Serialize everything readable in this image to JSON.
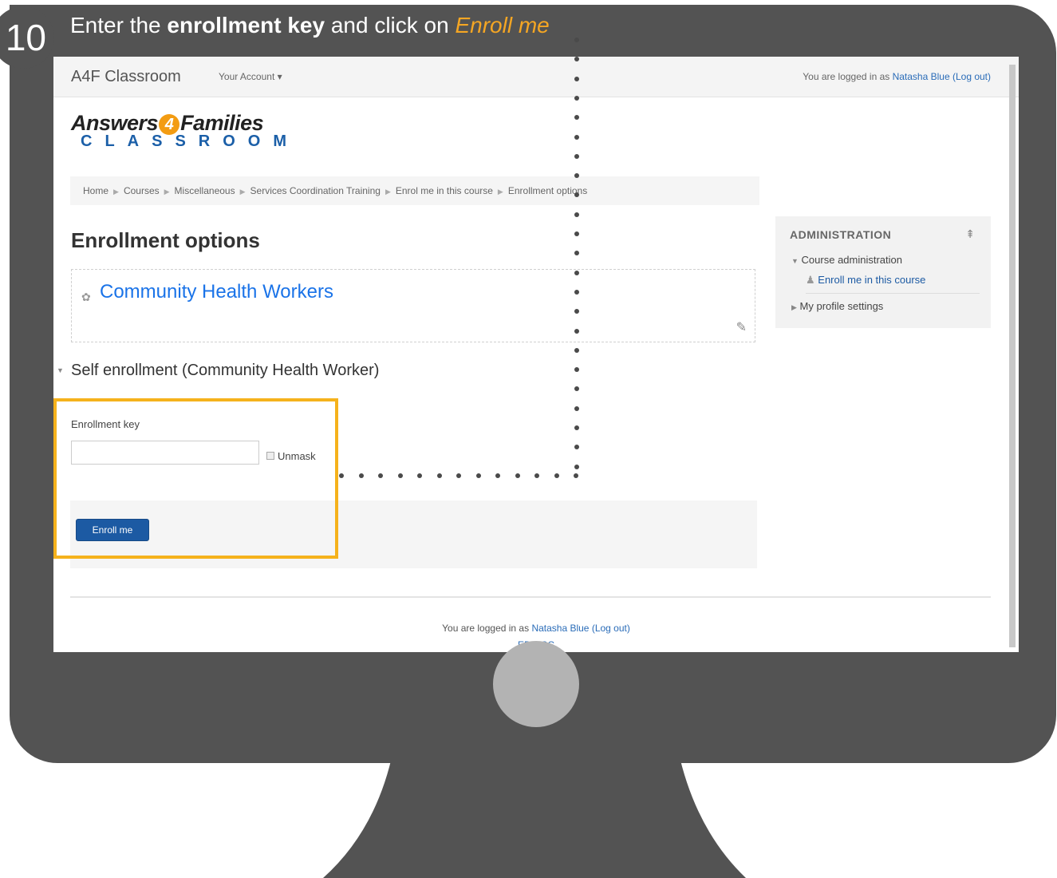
{
  "step": {
    "number": "10",
    "text_before": "Enter the ",
    "text_bold": "enrollment key",
    "text_middle": " and click on ",
    "text_italic": "Enroll me"
  },
  "navbar": {
    "site_name": "A4F Classroom",
    "account_menu": "Your Account ▾",
    "login_prefix": "You are logged in as ",
    "user_name": "Natasha Blue",
    "logout": "(Log out)"
  },
  "logo": {
    "line1_a": "Answers",
    "line1_num": "4",
    "line1_b": "Families",
    "line2": "CLASSROOM"
  },
  "breadcrumb": [
    "Home",
    "Courses",
    "Miscellaneous",
    "Services Coordination Training",
    "Enrol me in this course",
    "Enrollment options"
  ],
  "main": {
    "page_title": "Enrollment options",
    "course_name": "Community Health Workers",
    "self_enrollment_title": "Self enrollment (Community Health Worker)",
    "enrollment_key_label": "Enrollment key",
    "enrollment_key_value": "",
    "unmask_label": "Unmask",
    "enroll_button": "Enroll me"
  },
  "admin": {
    "title": "ADMINISTRATION",
    "course_admin": "Course administration",
    "enrol_link": "Enroll me in this course",
    "profile_settings": "My profile settings"
  },
  "footer": {
    "login_prefix": "You are logged in as ",
    "user_name": "Natasha Blue",
    "logout": "(Log out)",
    "code": "EDN-SC"
  },
  "colors": {
    "monitor": "#535353",
    "highlight": "#f5b21c",
    "accent_italic": "#f5a623",
    "button": "#1c5aa3"
  }
}
